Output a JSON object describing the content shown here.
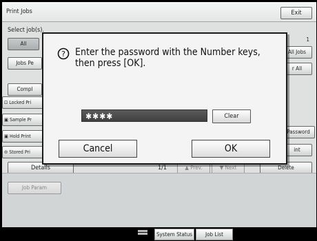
{
  "header": {
    "title": "Print Jobs",
    "exit_label": "Exit"
  },
  "select_label": "Select job(s).",
  "page_count_top": "1",
  "left_buttons": {
    "all": "All",
    "jobs_per": "Jobs Pe",
    "complete": "Compl",
    "locked": "Locked Pri",
    "sample": "Sample Pr",
    "hold": "Hold Print",
    "stored": "Stored Pri"
  },
  "right_buttons": {
    "all_jobs": "All Jobs",
    "clear_all": "r All",
    "password": "Password",
    "print": "int",
    "delete": "Delete"
  },
  "details_label": "Details",
  "page_indicator": "1/1",
  "prev_label": "▲ Prev.",
  "next_label": "▼ Next",
  "job_param_label": "Job Param",
  "status_bar": {
    "system_status": "System Status",
    "job_list": "Job List"
  },
  "dialog": {
    "message_line1": "Enter the password with the Number keys,",
    "message_line2": "then press [OK].",
    "password_mask": "✱✱✱✱",
    "clear_label": "Clear",
    "cancel_label": "Cancel",
    "ok_label": "OK"
  }
}
